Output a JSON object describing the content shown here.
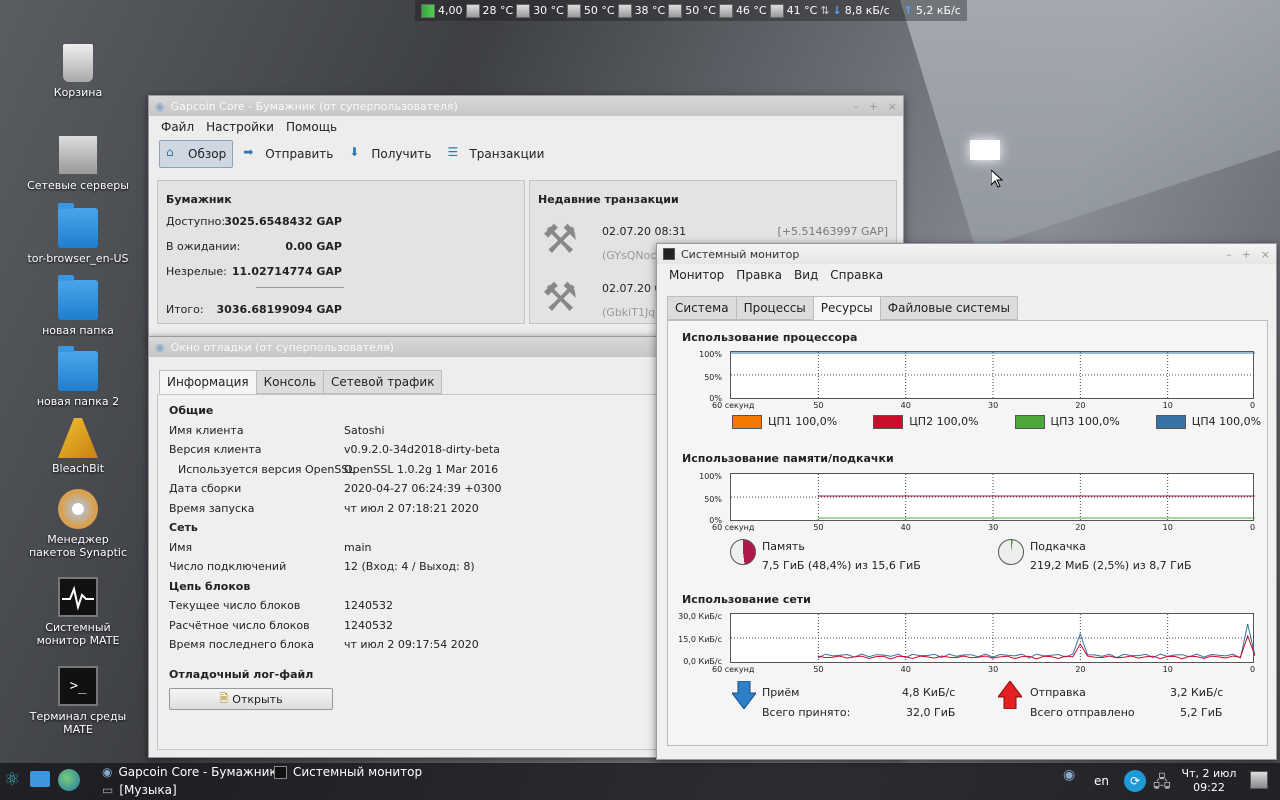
{
  "topbar": {
    "load": "4,00",
    "temps": [
      "28 °C",
      "30 °C",
      "50 °C",
      "38 °C",
      "50 °C",
      "46 °C",
      "41 °C"
    ],
    "down": "8,8 кБ/с",
    "up": "5,2 кБ/с"
  },
  "desktop": {
    "icons": [
      "Корзина",
      "Сетевые серверы",
      "tor-browser_en-US",
      "новая папка",
      "новая папка 2",
      "BleachBit",
      "Менеджер пакетов Synaptic",
      "Системный монитор MATE",
      "Терминал среды MATE"
    ]
  },
  "wallet": {
    "title": "Gapcoin Core - Бумажник (от суперпользователя)",
    "menu": [
      "Файл",
      "Настройки",
      "Помощь"
    ],
    "toolbar": [
      "Обзор",
      "Отправить",
      "Получить",
      "Транзакции"
    ],
    "balance": {
      "header": "Бумажник",
      "available_label": "Доступно:",
      "available": "3025.6548432 GAP",
      "pending_label": "В ожидании:",
      "pending": "0.00 GAP",
      "immature_label": "Незрелые:",
      "immature": "11.02714774 GAP",
      "total_label": "Итого:",
      "total": "3036.68199094 GAP"
    },
    "recent": {
      "header": "Недавние транзакции",
      "tx": [
        {
          "date": "02.07.20 08:31",
          "amount": "[+5.51463997 GAP]",
          "addr": "(GYsQNocj"
        },
        {
          "date": "02.07.20 08",
          "addr": "(GbkiT1JqR"
        }
      ]
    }
  },
  "debug": {
    "title": "Окно отладки (от суперпользователя)",
    "tabs": [
      "Информация",
      "Консоль",
      "Сетевой трафик"
    ],
    "general": "Общие",
    "client_name_label": "Имя клиента",
    "client_name": "Satoshi",
    "client_version_label": "Версия клиента",
    "client_version": "v0.9.2.0-34d2018-dirty-beta",
    "openssl_label": "Используется версия OpenSSL",
    "openssl": "OpenSSL 1.0.2g  1 Mar 2016",
    "build_label": "Дата сборки",
    "build": "2020-04-27 06:24:39 +0300",
    "start_label": "Время запуска",
    "start": "чт июл 2 07:18:21 2020",
    "network": "Сеть",
    "name_label": "Имя",
    "name": "main",
    "conn_label": "Число подключений",
    "conn": "12 (Вход: 4 / Выход: 8)",
    "chain": "Цепь блоков",
    "blocks_label": "Текущее число блоков",
    "blocks": "1240532",
    "est_label": "Расчётное число блоков",
    "est": "1240532",
    "last_label": "Время последнего блока",
    "last": "чт июл 2 09:17:54 2020",
    "log": "Отладочный лог-файл",
    "open": "Открыть"
  },
  "sysmon": {
    "title": "Системный монитор",
    "menu": [
      "Монитор",
      "Правка",
      "Вид",
      "Справка"
    ],
    "tabs": [
      "Система",
      "Процессы",
      "Ресурсы",
      "Файловые системы"
    ],
    "cpu_header": "Использование процессора",
    "cpu_y": [
      "100%",
      "50%",
      "0%"
    ],
    "x_ticks": [
      "60 секунд",
      "50",
      "40",
      "30",
      "20",
      "10",
      "0"
    ],
    "cpus": [
      {
        "label": "ЦП1",
        "value": "100,0%",
        "color": "#f57900"
      },
      {
        "label": "ЦП2",
        "value": "100,0%",
        "color": "#cc0e2e"
      },
      {
        "label": "ЦП3",
        "value": "100,0%",
        "color": "#4ca838"
      },
      {
        "label": "ЦП4",
        "value": "100,0%",
        "color": "#3573a6"
      }
    ],
    "mem_header": "Использование памяти/подкачки",
    "mem_label": "Память",
    "mem_value": "7,5 ГиБ (48,4%) из 15,6 ГиБ",
    "swap_label": "Подкачка",
    "swap_value": "219,2 МиБ (2,5%) из 8,7 ГиБ",
    "net_header": "Использование сети",
    "net_y": [
      "30,0 КиБ/с",
      "15,0 КиБ/с",
      "0,0 КиБ/с"
    ],
    "recv_label": "Приём",
    "recv_rate": "4,8 КиБ/с",
    "recv_total_label": "Всего принято:",
    "recv_total": "32,0 ГиБ",
    "send_label": "Отправка",
    "send_rate": "3,2 КиБ/с",
    "send_total_label": "Всего отправлено",
    "send_total": "5,2 ГиБ"
  },
  "taskbar": {
    "items": [
      "Gapcoin Core - Бумажник...",
      "Системный монитор",
      "[Музыка]"
    ],
    "lang": "en",
    "date": "Чт, 2 июл",
    "time": "09:22"
  }
}
